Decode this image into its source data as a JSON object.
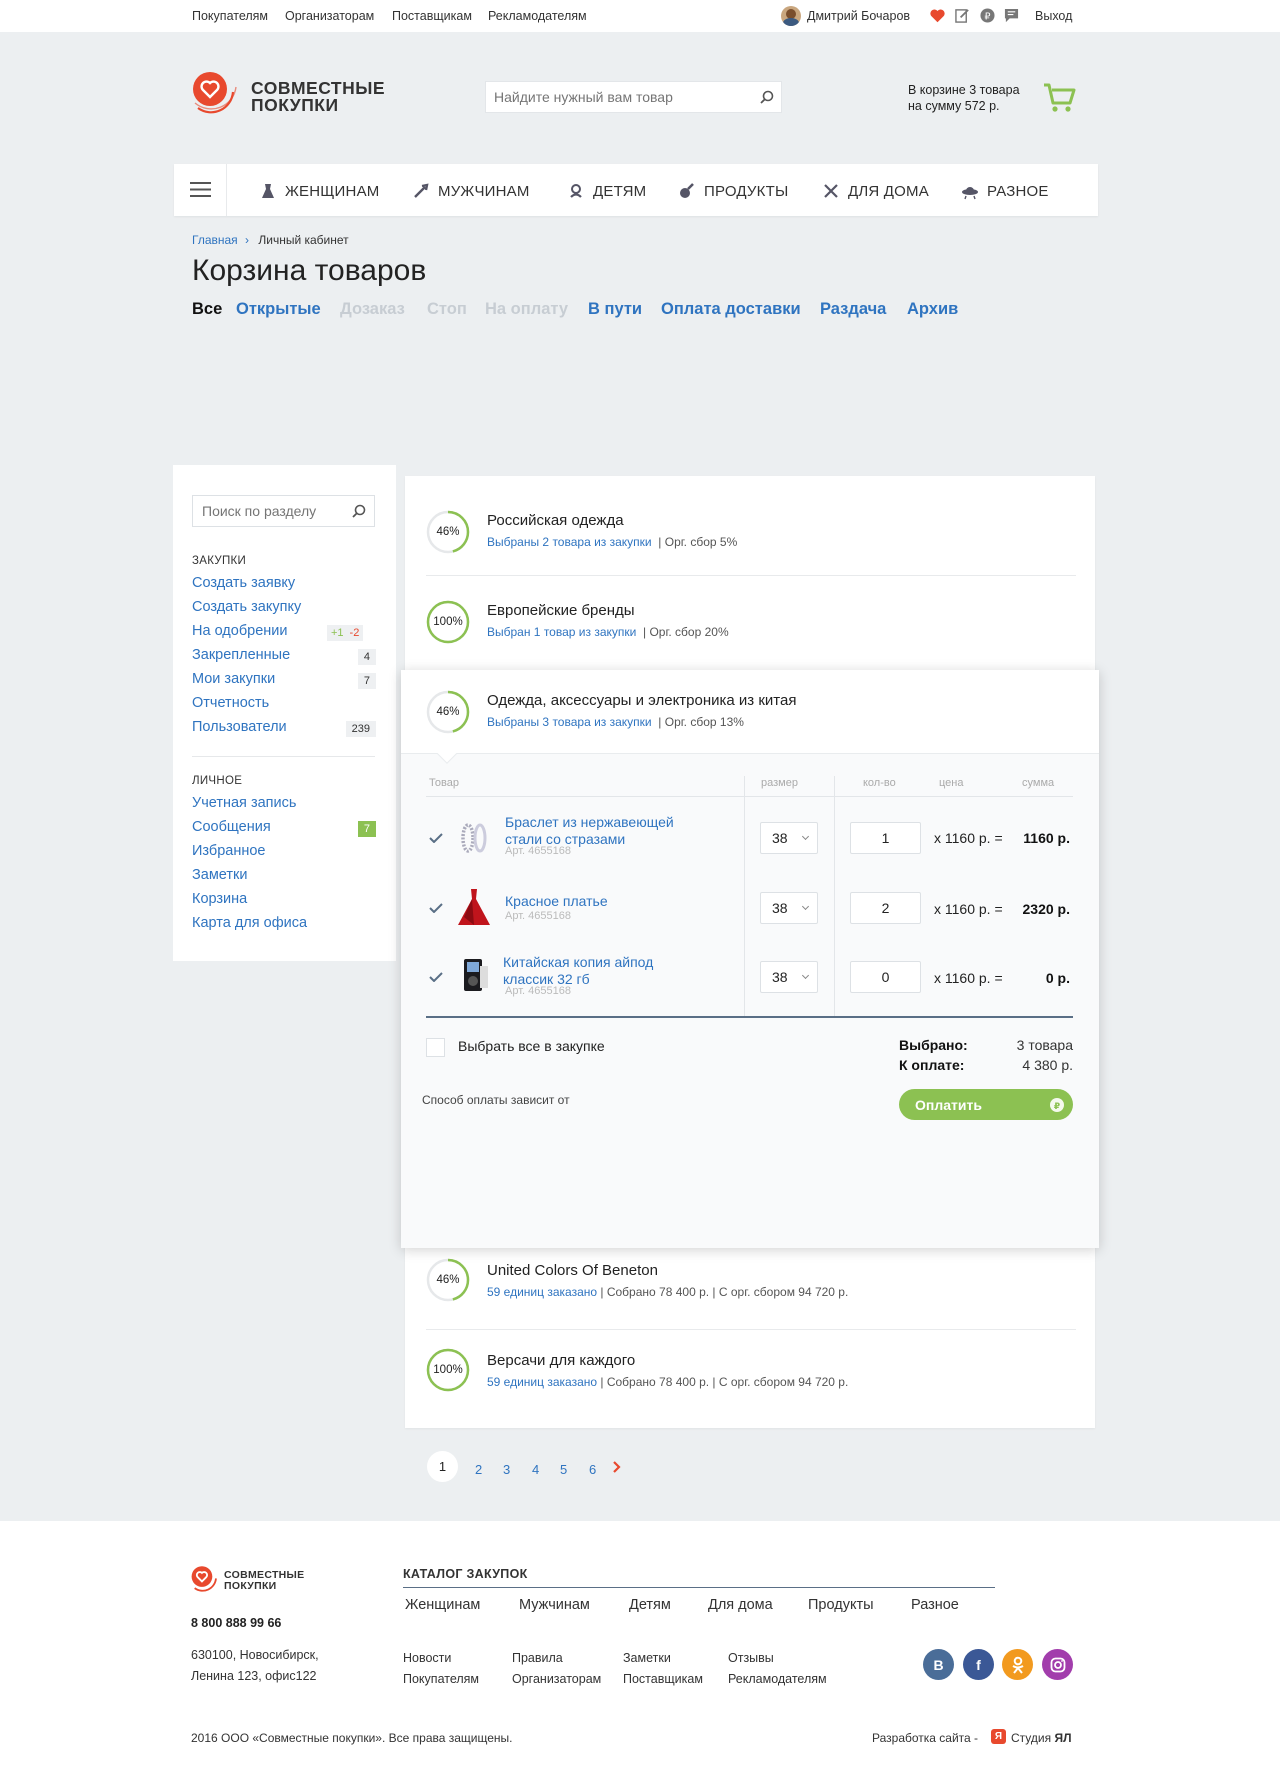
{
  "topbar": {
    "links": [
      "Покупателям",
      "Организаторам",
      "Поставщикам",
      "Рекламодателям"
    ],
    "user_name": "Дмитрий Бочаров",
    "logout": "Выход"
  },
  "header": {
    "logo_line1": "СОВМЕСТНЫЕ",
    "logo_line2": "ПОКУПКИ",
    "search_placeholder": "Найдите нужный вам товар",
    "cart_line1": "В корзине 3 товара",
    "cart_line2": "на сумму 572 р."
  },
  "nav": {
    "items": [
      "ЖЕНЩИНАМ",
      "МУЖЧИНАМ",
      "ДЕТЯМ",
      "ПРОДУКТЫ",
      "ДЛЯ ДОМА",
      "РАЗНОЕ"
    ]
  },
  "breadcrumb": {
    "home": "Главная",
    "current": "Личный кабинет"
  },
  "page_title": "Корзина товаров",
  "tabs": [
    "Все",
    "Открытые",
    "Дозаказ",
    "Стоп",
    "На оплату",
    "В пути",
    "Оплата доставки",
    "Раздача",
    "Архив"
  ],
  "sidebar": {
    "search_placeholder": "Поиск по разделу",
    "section1": "ЗАКУПКИ",
    "items1": [
      "Создать заявку",
      "Создать закупку",
      "На одобрении",
      "Закрепленные",
      "Мои закупки",
      "Отчетность",
      "Пользователи"
    ],
    "badge_plus": "+1",
    "badge_minus": "-2",
    "count_fixed": "4",
    "count_mine": "7",
    "count_users": "239",
    "section2": "ЛИЧНОЕ",
    "items2": [
      "Учетная запись",
      "Сообщения",
      "Избранное",
      "Заметки",
      "Корзина",
      "Карта для офиса"
    ],
    "count_messages": "7"
  },
  "purchases": [
    {
      "progress": "46%",
      "progress_value": 0.46,
      "title": "Российская одежда",
      "link": "Выбраны 2 товара из закупки",
      "info": "| Орг. сбор 5%"
    },
    {
      "progress": "100%",
      "progress_value": 1.0,
      "title": "Европейские бренды",
      "link": "Выбран 1 товар из закупки",
      "info": "| Орг. сбор 20%"
    },
    {
      "progress": "46%",
      "progress_value": 0.46,
      "title": "Одежда, аксессуары и электроника из китая",
      "link": "Выбраны 3 товара из закупки",
      "info": "| Орг. сбор 13%"
    },
    {
      "progress": "46%",
      "progress_value": 0.46,
      "title": "United Colors Of Beneton",
      "link": "59 единиц заказано",
      "info": "| Собрано 78 400 р. | С орг. сбором 94 720 р."
    },
    {
      "progress": "100%",
      "progress_value": 1.0,
      "title": "Версачи для каждого",
      "link": "59 единиц заказано",
      "info": "| Собрано 78 400 р. | С орг. сбором 94 720 р."
    }
  ],
  "table": {
    "headers": [
      "Товар",
      "размер",
      "кол-во",
      "цена",
      "сумма"
    ],
    "rows": [
      {
        "name1": "Браслет из нержавеющей",
        "name2": "стали со стразами",
        "art": "Арт. 4655168",
        "size": "38",
        "qty": "1",
        "price": "x  1160 р.  =",
        "sum": "1160 р."
      },
      {
        "name1": "Красное платье",
        "name2": "",
        "art": "Арт. 4655168",
        "size": "38",
        "qty": "2",
        "price": "x  1160 р.  =",
        "sum": "2320 р."
      },
      {
        "name1": "Китайская копия айпод",
        "name2": "классик 32 гб",
        "art": "Арт. 4655168",
        "size": "38",
        "qty": "0",
        "price": "x  1160 р.  =",
        "sum": "0 р."
      }
    ]
  },
  "summary": {
    "select_all": "Выбрать все в закупке",
    "selected_label": "Выбрано:",
    "selected_value": "3 товара",
    "pay_label": "К оплате:",
    "pay_value": "4 380 р.",
    "payment_note": "Способ оплаты зависит от",
    "pay_button": "Оплатить"
  },
  "pagination": [
    "1",
    "2",
    "3",
    "4",
    "5",
    "6"
  ],
  "footer": {
    "logo_line1": "СОВМЕСТНЫЕ",
    "logo_line2": "ПОКУПКИ",
    "phone": "8 800 888 99 66",
    "address1": "630100, Новосибирск,",
    "address2": "Ленина 123,  офис122",
    "catalog_title": "КАТАЛОГ ЗАКУПОК",
    "catalog": [
      "Женщинам",
      "Мужчинам",
      "Детям",
      "Для дома",
      "Продукты",
      "Разное"
    ],
    "links_row1": [
      "Новости",
      "Правила",
      "Заметки",
      "Отзывы"
    ],
    "links_row2": [
      "Покупателям",
      "Организаторам",
      "Поставщикам",
      "Рекламодателям"
    ],
    "copyright": "2016 ООО «Совместные покупки». Все права защищены.",
    "dev_label": "Разработка сайта -",
    "dev_name": "Студия",
    "dev_brand": "ЯЛ",
    "social": [
      "B",
      "f",
      "ok",
      "ig"
    ]
  },
  "colors": {
    "accent_green": "#8cc152",
    "link_blue": "#2f74c0",
    "brand_red": "#e8492e",
    "bg": "#eceff1"
  }
}
